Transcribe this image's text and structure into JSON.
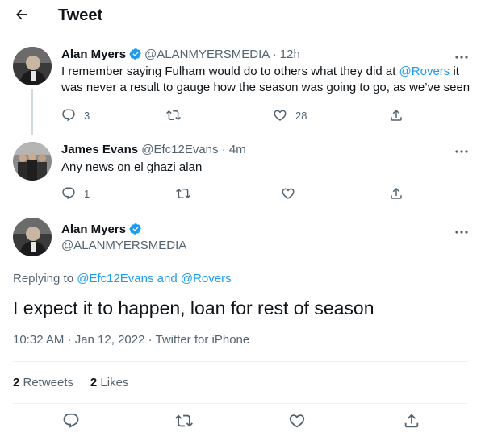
{
  "header": {
    "title": "Tweet",
    "back_icon": "arrow-left-icon"
  },
  "colors": {
    "accent": "#1d9bf0",
    "muted": "#536471",
    "text": "#0f1419",
    "divider": "#eff3f4"
  },
  "tweets": [
    {
      "name": "Alan Myers",
      "handle_time": "@ALANMYERSMEDIA · 12h",
      "text_before": "I remember saying Fulham would do to others what they did at ",
      "mention": "@Rovers",
      "text_after": " it was never a result to gauge how the season was going to go, as we’ve seen",
      "replies": "3",
      "retweets": "",
      "likes": "28"
    },
    {
      "name": "James Evans",
      "handle_time": "@Efc12Evans · 4m",
      "text": "Any news on el ghazi alan",
      "replies": "1",
      "retweets": "",
      "likes": ""
    }
  ],
  "main_tweet": {
    "name": "Alan Myers",
    "handle": "@ALANMYERSMEDIA",
    "replying_prefix": "Replying to ",
    "replying_to": "@Efc12Evans and @Rovers",
    "text": "I expect it to happen, loan for rest of season",
    "timestamp": "10:32 AM · Jan 12, 2022 · Twitter for iPhone",
    "retweets_count": "2",
    "retweets_label": " Retweets",
    "likes_count": "2",
    "likes_label": " Likes"
  }
}
